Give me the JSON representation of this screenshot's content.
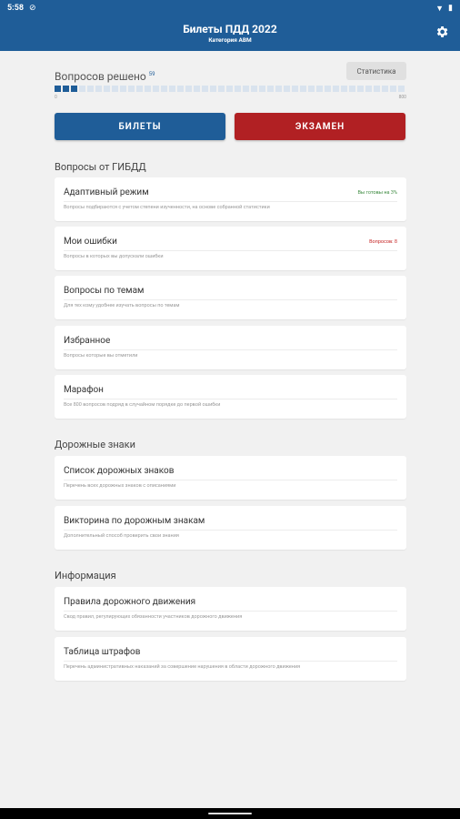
{
  "status_bar": {
    "time": "5:58"
  },
  "header": {
    "title": "Билеты ПДД 2022",
    "subtitle": "Категория ABM"
  },
  "progress": {
    "label": "Вопросов решено",
    "solved": "59",
    "min_label": "0",
    "max_label": "800",
    "stats_label": "Статистика",
    "total_cells": 43,
    "filled_cells": 3
  },
  "buttons": {
    "tickets": "БИЛЕТЫ",
    "exam": "ЭКЗАМЕН"
  },
  "sections": [
    {
      "title": "Вопросы от ГИБДД",
      "items": [
        {
          "title": "Адаптивный режим",
          "desc": "Вопросы подбираются с учетом степени изученности, на основе собранной статистики",
          "badge": "Вы готовы на 3%",
          "badge_color": "#3c8a3f"
        },
        {
          "title": "Мои ошибки",
          "desc": "Вопросы в которых вы допускали ошибки",
          "badge": "Вопросов: 8",
          "badge_color": "#c62828"
        },
        {
          "title": "Вопросы по темам",
          "desc": "Для тех кому удобнее изучать вопросы по темам"
        },
        {
          "title": "Избранное",
          "desc": "Вопросы которые вы отметили"
        },
        {
          "title": "Марафон",
          "desc": "Все 800 вопросов подряд в случайном порядке до первой ошибки"
        }
      ]
    },
    {
      "title": "Дорожные знаки",
      "items": [
        {
          "title": "Список дорожных знаков",
          "desc": "Перечень всех дорожных знаков с описаниями"
        },
        {
          "title": "Викторина по дорожным знакам",
          "desc": "Дополнительный способ проверить свои знания"
        }
      ]
    },
    {
      "title": "Информация",
      "items": [
        {
          "title": "Правила дорожного движения",
          "desc": "Свод правил, регулирующих обязанности участников дорожного движения"
        },
        {
          "title": "Таблица штрафов",
          "desc": "Перечень административных наказаний за совершение нарушения в области дорожного движения"
        }
      ]
    }
  ],
  "colors": {
    "primary": "#1f5d98",
    "exam": "#b12023",
    "background": "#f1f1f1"
  }
}
